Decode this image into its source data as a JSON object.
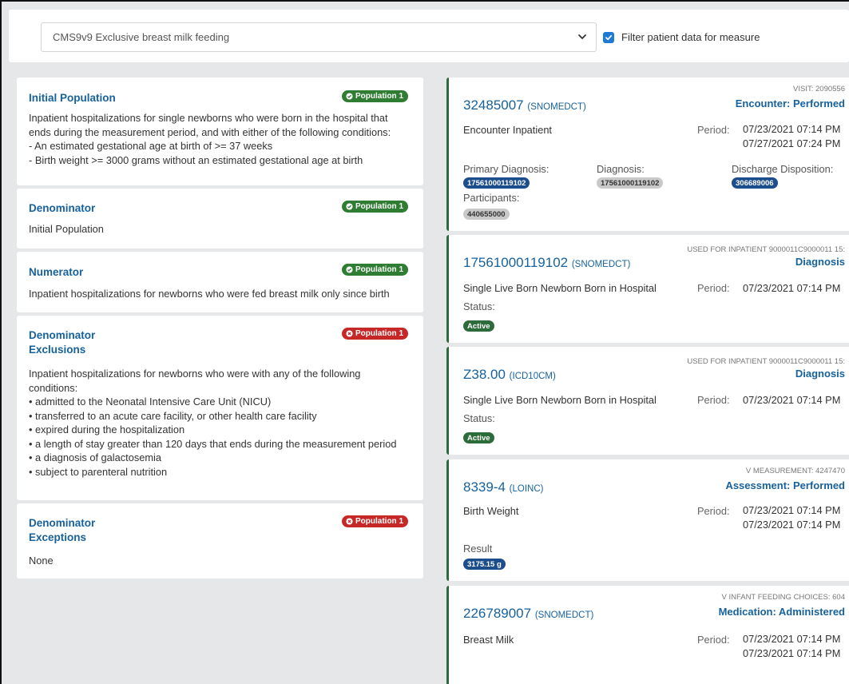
{
  "header": {
    "measure_select": "CMS9v9 Exclusive breast milk feeding",
    "filter_label": "Filter patient data for measure",
    "filter_checked": true
  },
  "populations": [
    {
      "title_lines": [
        "Initial Population"
      ],
      "badge": "Population 1",
      "badge_status": "met",
      "body_lines": [
        "Inpatient hospitalizations for single newborns who were born in the hospital that",
        "ends during the measurement period, and with either of the following conditions:",
        "- An estimated gestational age at birth of >= 37 weeks",
        "- Birth weight >= 3000 grams without an estimated gestational age at birth"
      ]
    },
    {
      "title_lines": [
        "Denominator"
      ],
      "badge": "Population 1",
      "badge_status": "met",
      "body_lines": [
        "Initial Population"
      ]
    },
    {
      "title_lines": [
        "Numerator"
      ],
      "badge": "Population 1",
      "badge_status": "met",
      "body_lines": [
        "Inpatient hospitalizations for newborns who were fed breast milk only since birth"
      ]
    },
    {
      "title_lines": [
        "Denominator",
        "Exclusions"
      ],
      "badge": "Population 1",
      "badge_status": "not-met",
      "body_lines": [
        "Inpatient hospitalizations for newborns who were with any of the following",
        "conditions:",
        "• admitted to the Neonatal Intensive Care Unit (NICU)",
        "• transferred to an acute care facility, or other health care facility",
        "• expired during the hospitalization",
        "• a length of stay greater than 120 days that ends during the measurement period",
        "• a diagnosis of galactosemia",
        "• subject to parenteral nutrition"
      ]
    },
    {
      "title_lines": [
        "Denominator",
        "Exceptions"
      ],
      "badge": "Population 1",
      "badge_status": "not-met",
      "body_lines": [
        "None"
      ]
    }
  ],
  "data_elements": [
    {
      "meta": "VISIT: 2090556",
      "type": "Encounter: Performed",
      "code": "32485007",
      "system": "(SNOMEDCT)",
      "description": "Encounter Inpatient",
      "period_label": "Period:",
      "period": [
        "07/23/2021 07:14 PM",
        "07/27/2021 07:24 PM"
      ],
      "primary_diagnosis_label": "Primary Diagnosis:",
      "primary_diagnosis": "17561000119102",
      "diagnosis_label": "Diagnosis:",
      "diagnosis": "17561000119102",
      "discharge_label": "Discharge Disposition:",
      "discharge": "306689006",
      "participants_label": "Participants:",
      "participants": "440655000"
    },
    {
      "meta": "USED FOR INPATIENT 9000011C9000011 15:",
      "type": "Diagnosis",
      "code": "17561000119102",
      "system": "(SNOMEDCT)",
      "description": "Single Live Born Newborn Born in Hospital",
      "period_label": "Period:",
      "period": [
        "07/23/2021 07:14 PM"
      ],
      "status_label": "Status:",
      "status": "Active"
    },
    {
      "meta": "USED FOR INPATIENT 9000011C9000011 15:",
      "type": "Diagnosis",
      "code": "Z38.00",
      "system": "(ICD10CM)",
      "description": "Single Live Born Newborn Born in Hospital",
      "period_label": "Period:",
      "period": [
        "07/23/2021 07:14 PM"
      ],
      "status_label": "Status:",
      "status": "Active"
    },
    {
      "meta": "V MEASUREMENT: 4247470",
      "type": "Assessment: Performed",
      "code": "8339-4",
      "system": "(LOINC)",
      "description": "Birth Weight",
      "period_label": "Period:",
      "period": [
        "07/23/2021 07:14 PM",
        "07/23/2021 07:14 PM"
      ],
      "result_label": "Result",
      "result": "3175.15 g"
    },
    {
      "meta": "V INFANT FEEDING CHOICES: 604",
      "type": "Medication: Administered",
      "code": "226789007",
      "system": "(SNOMEDCT)",
      "description": "Breast Milk",
      "period_label": "Period:",
      "period": [
        "07/23/2021 07:14 PM",
        "07/23/2021 07:14 PM"
      ]
    }
  ]
}
